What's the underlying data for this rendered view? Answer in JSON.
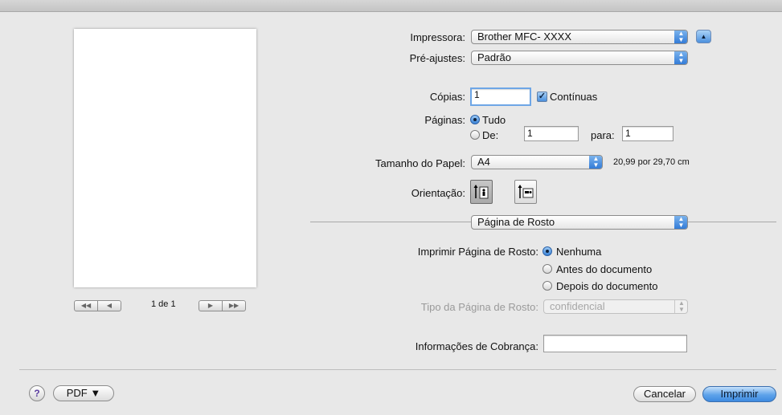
{
  "preview": {
    "page_label": "1 de 1",
    "nav_left": [
      "◀◀",
      "◀"
    ],
    "nav_right": [
      "▶",
      "▶▶"
    ]
  },
  "printer": {
    "label": "Impressora:",
    "value": "Brother MFC- XXXX"
  },
  "presets": {
    "label": "Pré-ajustes:",
    "value": "Padrão"
  },
  "copies": {
    "label": "Cópias:",
    "value": "1",
    "collate_label": "Contínuas",
    "collate_checked": true
  },
  "pages": {
    "label": "Páginas:",
    "all_label": "Tudo",
    "from_label": "De:",
    "from_value": "1",
    "to_label": "para:",
    "to_value": "1",
    "selected": "all"
  },
  "paper_size": {
    "label": "Tamanho do Papel:",
    "value": "A4",
    "dimensions": "20,99 por 29,70 cm"
  },
  "orientation": {
    "label": "Orientação:",
    "selected": "portrait"
  },
  "section_popup": {
    "value": "Página de Rosto"
  },
  "cover_page": {
    "label": "Imprimir Página de Rosto:",
    "options": [
      "Nenhuma",
      "Antes do documento",
      "Depois do documento"
    ],
    "selected_index": 0
  },
  "cover_type": {
    "label": "Tipo da Página de Rosto:",
    "value": "confidencial",
    "disabled": true
  },
  "billing": {
    "label": "Informações de Cobrança:",
    "value": ""
  },
  "footer": {
    "help_label": "?",
    "pdf_label": "PDF ▼",
    "cancel_label": "Cancelar",
    "print_label": "Imprimir"
  },
  "colors": {
    "accent": "#3e8ae0",
    "focus_ring": "#6ea6e6",
    "background": "#e8e8e8"
  }
}
